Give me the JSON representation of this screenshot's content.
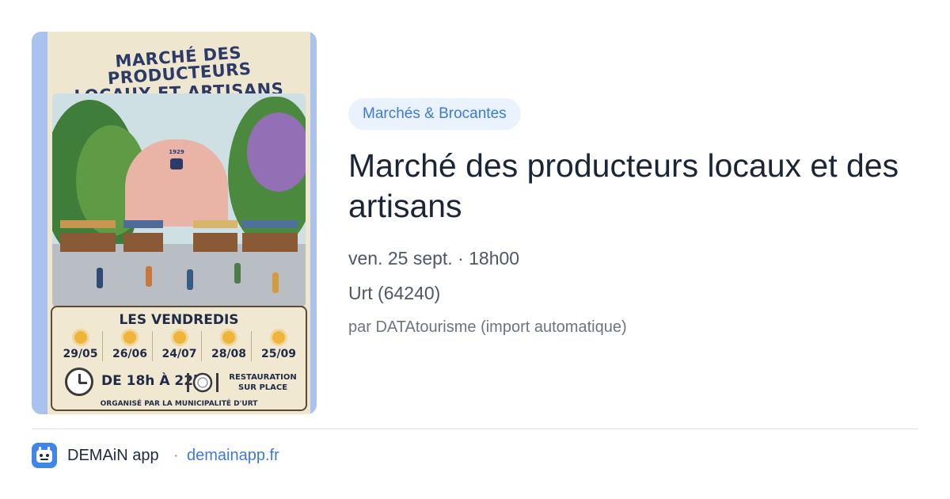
{
  "poster": {
    "title_line1": "MARCHÉ DES PRODUCTEURS",
    "title_line2": "LOCAUX ET ARTISANS",
    "fronton_year": "1929",
    "days_title": "LES VENDREDIS",
    "dates": [
      "29/05",
      "26/06",
      "24/07",
      "28/08",
      "25/09"
    ],
    "hours": "DE 18h À 22h",
    "restauration": "RESTAURATION SUR PLACE",
    "organise": "ORGANISÉ PAR LA MUNICIPALITÉ D'URT"
  },
  "event": {
    "category": "Marchés & Brocantes",
    "title": "Marché des producteurs locaux et des artisans",
    "date": "ven. 25 sept. · 18h00",
    "place": "Urt (64240)",
    "source": "par DATAtourisme (import automatique)"
  },
  "footer": {
    "app_name": "DEMAiN app",
    "separator": "·",
    "url": "demainapp.fr"
  },
  "colors": {
    "accent": "#3d7ad8",
    "pill_bg": "#e9f2fd",
    "poster_frame": "#a9c3ee",
    "title_text": "#1a2638"
  },
  "icons": {
    "app": "demain-app-icon",
    "sun": "sun-icon",
    "clock": "clock-icon",
    "cutlery": "cutlery-icon"
  }
}
